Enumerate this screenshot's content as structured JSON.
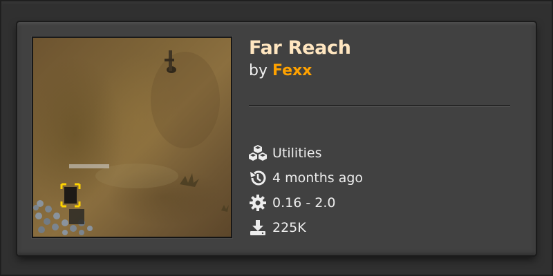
{
  "mod": {
    "title": "Far Reach",
    "by_prefix": "by",
    "author": "Fexx"
  },
  "meta": {
    "category": "Utilities",
    "updated": "4 months ago",
    "versions": "0.16 - 2.0",
    "downloads": "225K"
  },
  "icons": {
    "category": "cubes-icon",
    "updated": "history-icon",
    "versions": "gear-icon",
    "downloads": "download-icon"
  },
  "colors": {
    "title": "#ffe6c0",
    "author": "#ffa200",
    "card_bg": "#414141",
    "page_bg": "#2f2f2f"
  }
}
